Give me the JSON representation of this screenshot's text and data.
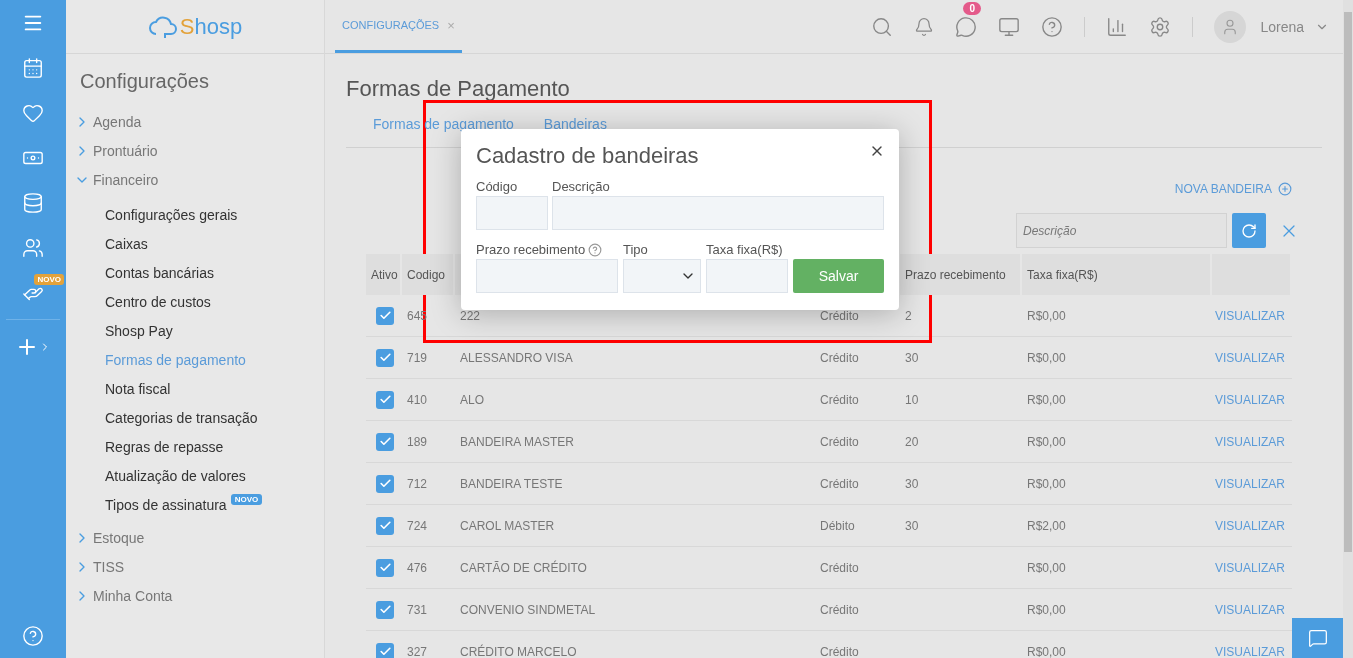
{
  "rail": {
    "badge": "NOVO"
  },
  "logo": {
    "initial": "S",
    "rest": "hosp"
  },
  "tab": {
    "label": "CONFIGURAÇÕES",
    "close": "×",
    "selected": true
  },
  "header": {
    "messages": "0",
    "user": "Lorena"
  },
  "sidebar": {
    "title": "Configurações",
    "items": [
      {
        "label": "Agenda",
        "expanded": false
      },
      {
        "label": "Prontuário",
        "expanded": false
      },
      {
        "label": "Financeiro",
        "expanded": true,
        "children": [
          {
            "label": "Configurações gerais",
            "selected": false
          },
          {
            "label": "Caixas",
            "selected": false
          },
          {
            "label": "Contas bancárias",
            "selected": false
          },
          {
            "label": "Centro de custos",
            "selected": false
          },
          {
            "label": "Shosp Pay",
            "selected": false
          },
          {
            "label": "Formas de pagamento",
            "selected": true
          },
          {
            "label": "Nota fiscal",
            "selected": false
          },
          {
            "label": "Categorias de transação",
            "selected": false
          },
          {
            "label": "Regras de repasse",
            "selected": false
          },
          {
            "label": "Atualização de valores",
            "selected": false
          },
          {
            "label": "Tipos de assinatura",
            "selected": false,
            "badge": "NOVO"
          }
        ]
      },
      {
        "label": "Estoque",
        "expanded": false
      },
      {
        "label": "TISS",
        "expanded": false
      },
      {
        "label": "Minha Conta",
        "expanded": false
      }
    ]
  },
  "page": {
    "title": "Formas de Pagamento",
    "tabs": [
      "Formas de pagamento",
      "Bandeiras"
    ],
    "new_button": "NOVA BANDEIRA",
    "search": {
      "placeholder": "Descrição"
    }
  },
  "table": {
    "columns": [
      "Ativo",
      "Codigo",
      "Prazo recebimento",
      "Taxa fixa(R$)"
    ],
    "rows": [
      {
        "active": true,
        "code": "645",
        "name": "222",
        "type": "Crédito",
        "term": "2",
        "fee": "R$0,00",
        "action": "VISUALIZAR"
      },
      {
        "active": true,
        "code": "719",
        "name": "ALESSANDRO VISA",
        "type": "Crédito",
        "term": "30",
        "fee": "R$0,00",
        "action": "VISUALIZAR"
      },
      {
        "active": true,
        "code": "410",
        "name": "ALO",
        "type": "Crédito",
        "term": "10",
        "fee": "R$0,00",
        "action": "VISUALIZAR"
      },
      {
        "active": true,
        "code": "189",
        "name": "BANDEIRA MASTER",
        "type": "Crédito",
        "term": "20",
        "fee": "R$0,00",
        "action": "VISUALIZAR"
      },
      {
        "active": true,
        "code": "712",
        "name": "BANDEIRA TESTE",
        "type": "Crédito",
        "term": "30",
        "fee": "R$0,00",
        "action": "VISUALIZAR"
      },
      {
        "active": true,
        "code": "724",
        "name": "CAROL MASTER",
        "type": "Débito",
        "term": "30",
        "fee": "R$2,00",
        "action": "VISUALIZAR"
      },
      {
        "active": true,
        "code": "476",
        "name": "CARTÃO DE CRÉDITO",
        "type": "Crédito",
        "fee": "R$0,00",
        "action": "VISUALIZAR"
      },
      {
        "active": true,
        "code": "731",
        "name": "CONVENIO SINDMETAL",
        "type": "Crédito",
        "fee": "R$0,00",
        "action": "VISUALIZAR"
      },
      {
        "active": true,
        "code": "327",
        "name": "CRÉDITO MARCELO",
        "type": "Crédito",
        "fee": "R$0,00",
        "action": "VISUALIZAR"
      }
    ]
  },
  "modal": {
    "title": "Cadastro de bandeiras",
    "fields": [
      {
        "label": "Código",
        "kind": "text"
      },
      {
        "label": "Descrição",
        "kind": "text"
      },
      {
        "label": "Prazo recebimento",
        "kind": "text",
        "help": true
      },
      {
        "label": "Tipo",
        "kind": "select"
      },
      {
        "label": "Taxa fixa(R$)",
        "kind": "text"
      }
    ],
    "submit": "Salvar"
  }
}
